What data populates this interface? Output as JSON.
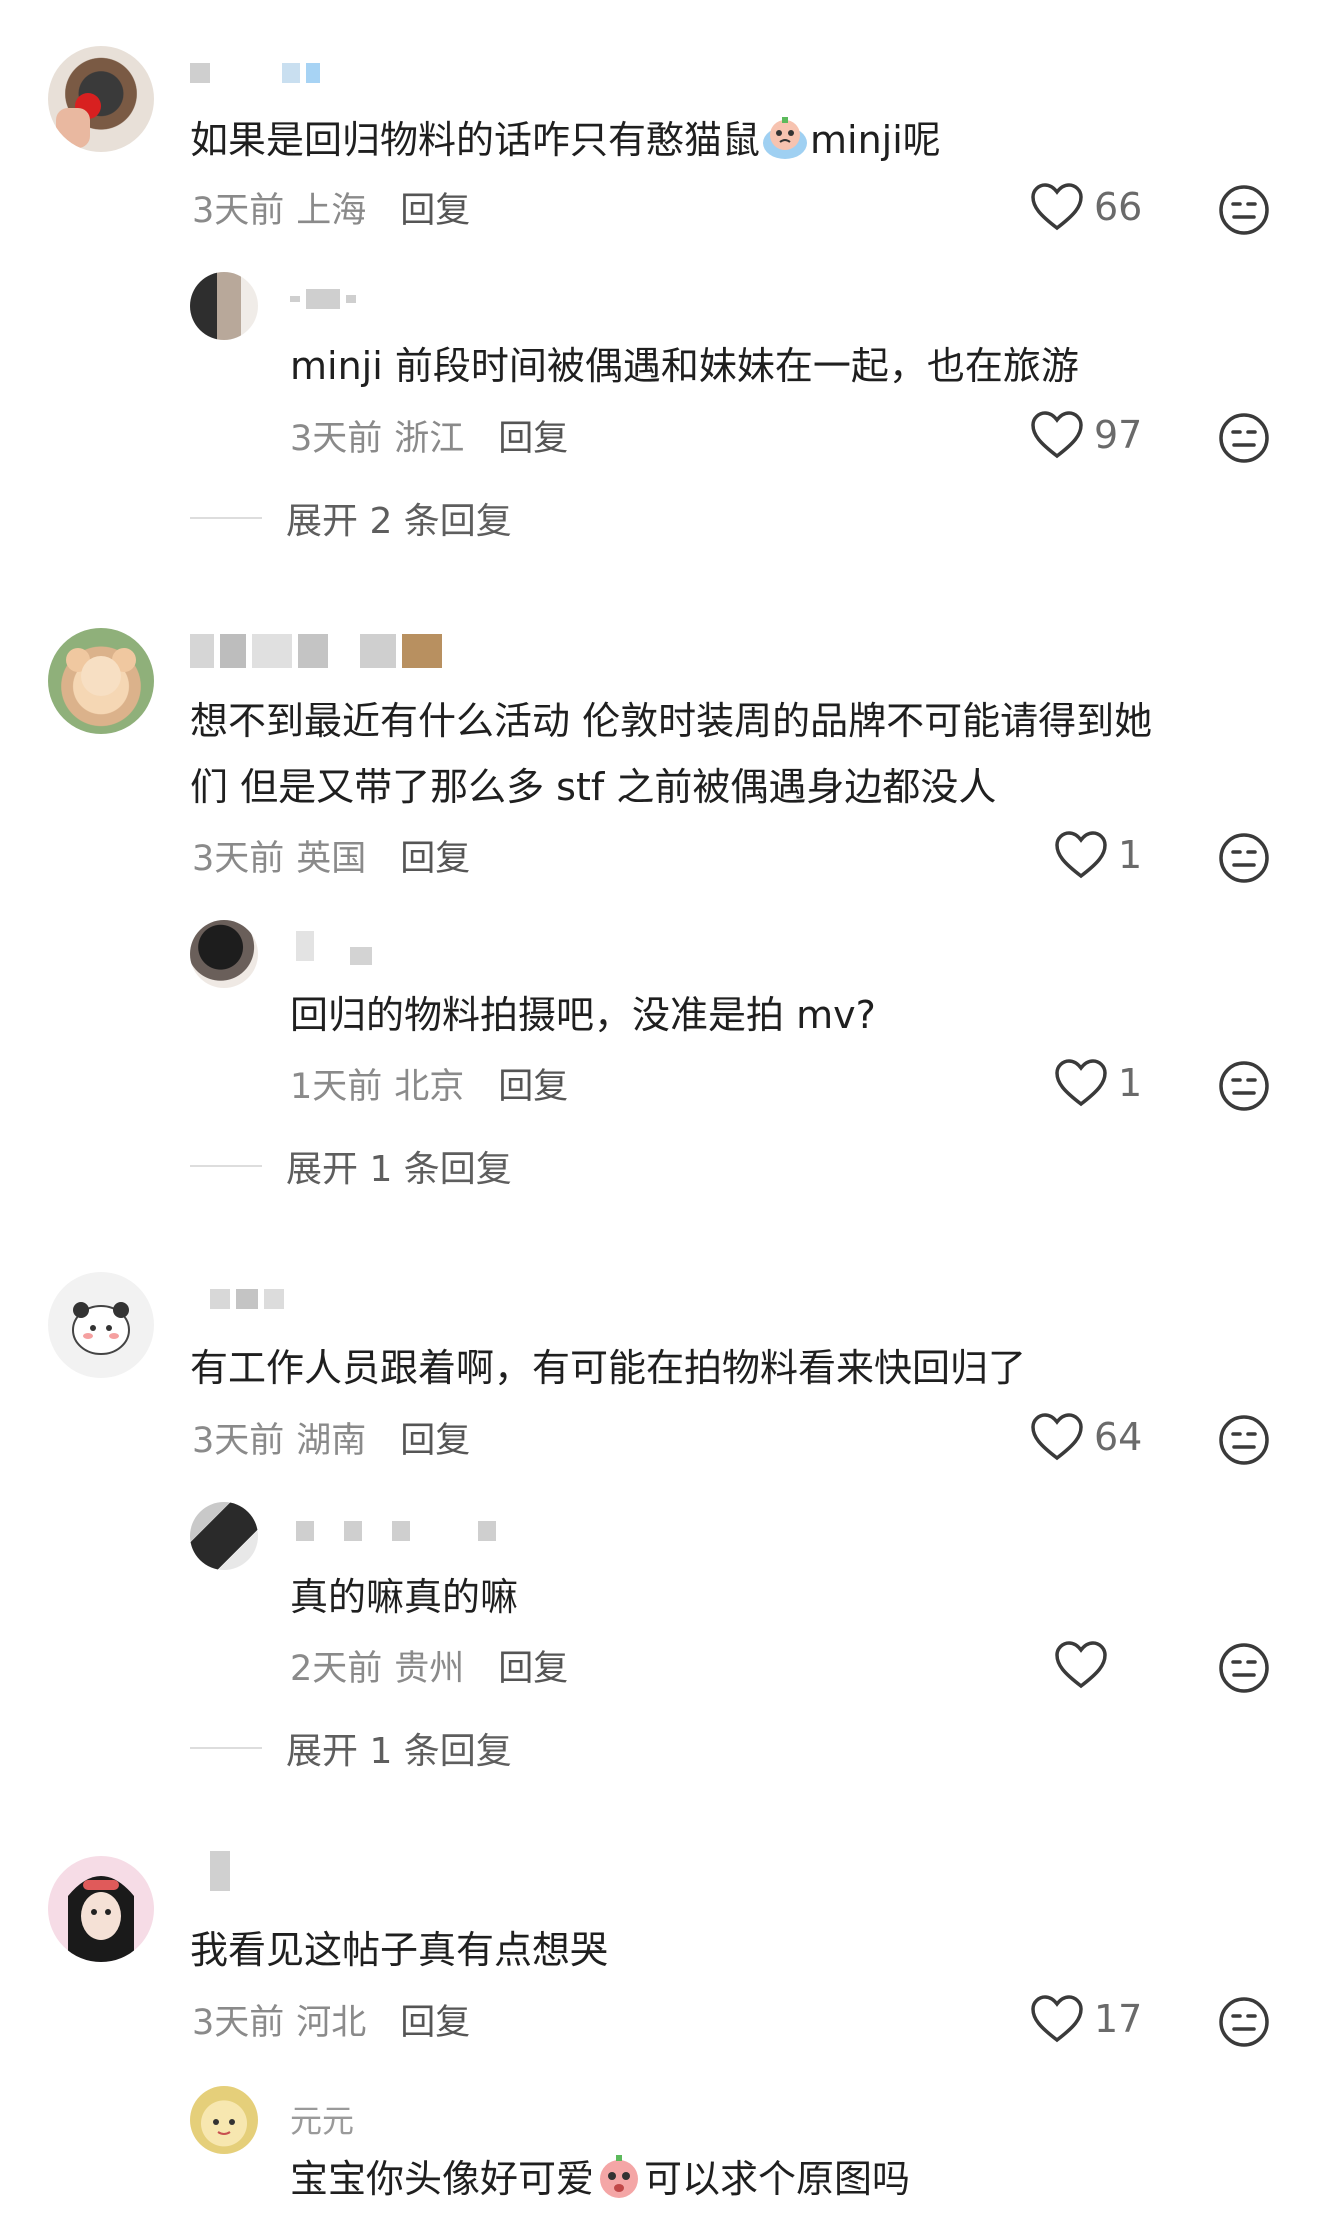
{
  "comments": [
    {
      "text_before": "如果是回归物料的话咋只有憨猫鼠",
      "text_after": "minji呢",
      "emoji": "crying-emoji",
      "time": "3天前",
      "location": "上海",
      "reply_label": "回复",
      "likes": "66",
      "replies": [
        {
          "text": "minji 前段时间被偶遇和妹妹在一起，也在旅游",
          "time": "3天前",
          "location": "浙江",
          "reply_label": "回复",
          "likes": "97"
        }
      ],
      "expand_label": "展开 2 条回复"
    },
    {
      "text_line1": "想不到最近有什么活动 伦敦时装周的品牌不可能请得到她",
      "text_line2": "们 但是又带了那么多 stf 之前被偶遇身边都没人",
      "time": "3天前",
      "location": "英国",
      "reply_label": "回复",
      "likes": "1",
      "replies": [
        {
          "text": "回归的物料拍摄吧，没准是拍 mv?",
          "time": "1天前",
          "location": "北京",
          "reply_label": "回复",
          "likes": "1"
        }
      ],
      "expand_label": "展开 1 条回复"
    },
    {
      "text": "有工作人员跟着啊，有可能在拍物料看来快回归了",
      "time": "3天前",
      "location": "湖南",
      "reply_label": "回复",
      "likes": "64",
      "replies": [
        {
          "text": "真的嘛真的嘛",
          "time": "2天前",
          "location": "贵州",
          "reply_label": "回复",
          "likes": ""
        }
      ],
      "expand_label": "展开 1 条回复"
    },
    {
      "text": "我看见这帖子真有点想哭",
      "time": "3天前",
      "location": "河北",
      "reply_label": "回复",
      "likes": "17",
      "replies": [
        {
          "username": "元元",
          "text_before": "宝宝你头像好可爱",
          "text_after": "可以求个原图吗",
          "emoji": "crying-emoji"
        }
      ]
    }
  ],
  "colors": {
    "text": "#1f1f1f",
    "meta": "#8a8a8a",
    "icon": "#3a3a3a",
    "emoji_pink": "#f4a6a6",
    "emoji_blue": "#9fd0f2"
  }
}
